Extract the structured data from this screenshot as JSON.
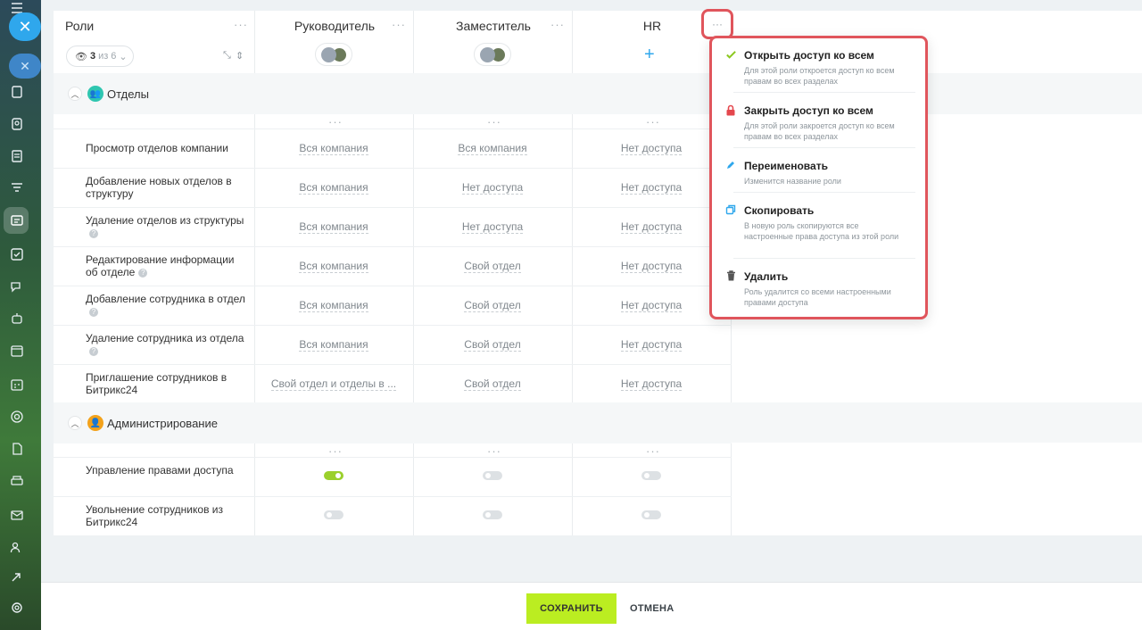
{
  "header": {
    "roles_title": "Роли",
    "roles_counter": {
      "shown": "3",
      "sep": "из",
      "total": "6"
    },
    "columns": [
      {
        "title": "Руководитель"
      },
      {
        "title": "Заместитель"
      },
      {
        "title": "HR"
      }
    ]
  },
  "sections": [
    {
      "title": "Отделы",
      "rows": [
        {
          "label": "Просмотр отделов компании",
          "help": false,
          "values": [
            "Вся компания",
            "Вся компания",
            "Нет доступа"
          ]
        },
        {
          "label": "Добавление новых отделов в структуру",
          "help": false,
          "values": [
            "Вся компания",
            "Нет доступа",
            "Нет доступа"
          ]
        },
        {
          "label": "Удаление отделов из структуры",
          "help": true,
          "values": [
            "Вся компания",
            "Нет доступа",
            "Нет доступа"
          ]
        },
        {
          "label": "Редактирование информации об отделе",
          "help": true,
          "values": [
            "Вся компания",
            "Свой отдел",
            "Нет доступа"
          ]
        },
        {
          "label": "Добавление сотрудника в отдел",
          "help": true,
          "values": [
            "Вся компания",
            "Свой отдел",
            "Нет доступа"
          ]
        },
        {
          "label": "Удаление сотрудника из отдела",
          "help": true,
          "values": [
            "Вся компания",
            "Свой отдел",
            "Нет доступа"
          ]
        },
        {
          "label": "Приглашение сотрудников в Битрикс24",
          "help": false,
          "values": [
            "Свой отдел и отделы в ...",
            "Свой отдел",
            "Нет доступа"
          ]
        }
      ]
    },
    {
      "title": "Администрирование",
      "rows": [
        {
          "label": "Управление правами доступа",
          "toggles": [
            true,
            false,
            false
          ]
        },
        {
          "label": "Увольнение сотрудников из Битрикс24",
          "toggles": [
            false,
            false,
            false
          ]
        }
      ]
    }
  ],
  "menu": {
    "items": [
      {
        "title": "Открыть доступ ко всем",
        "desc": "Для этой роли откроется доступ ко всем правам во всех разделах",
        "icon": "check-icon"
      },
      {
        "title": "Закрыть доступ ко всем",
        "desc": "Для этой роли закроется доступ ко всем правам во всех разделах",
        "icon": "lock-icon"
      },
      {
        "title": "Переименовать",
        "desc": "Изменится название роли",
        "icon": "pencil-icon"
      },
      {
        "title": "Скопировать",
        "desc": "В новую роль скопируются все настроенные права доступа из этой роли",
        "icon": "copy-icon"
      },
      {
        "title": "Удалить",
        "desc": "Роль удалится со всеми настроенными правами доступа",
        "icon": "trash-icon"
      }
    ]
  },
  "footer": {
    "save_label": "СОХРАНИТЬ",
    "cancel_label": "ОТМЕНА"
  },
  "colors": {
    "accent_green": "#bbed21",
    "toggle_on": "#9bd02c",
    "highlight_red": "#e0555c",
    "link_blue": "#2fa7ec"
  }
}
